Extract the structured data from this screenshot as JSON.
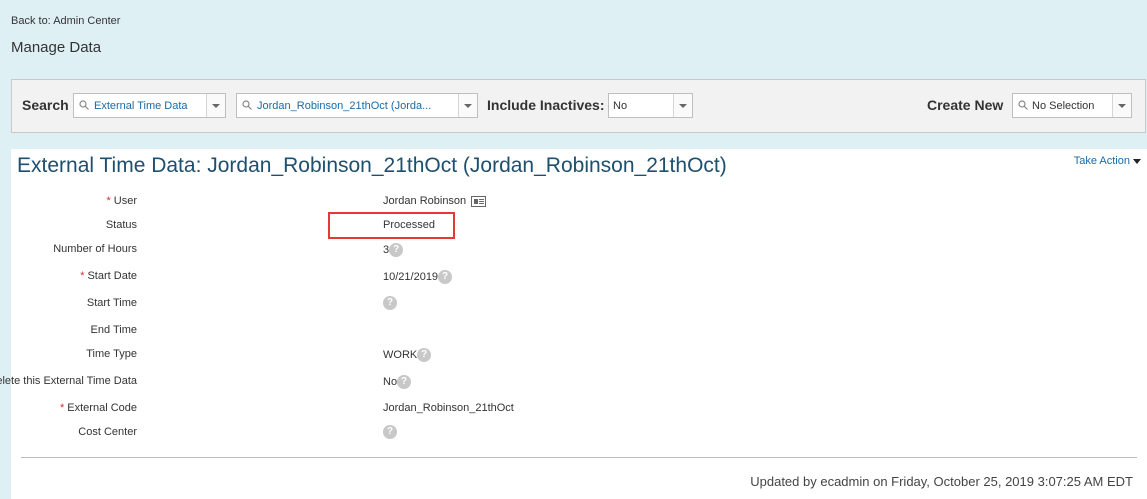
{
  "nav": {
    "back_label": "Back to: Admin Center"
  },
  "page": {
    "title": "Manage Data"
  },
  "search_bar": {
    "search_label": "Search",
    "object_type": "External Time Data",
    "record": "Jordan_Robinson_21thOct (Jorda...",
    "include_inactives_label": "Include Inactives:",
    "include_inactives_value": "No",
    "create_new_label": "Create New",
    "create_new_value": "No Selection"
  },
  "record": {
    "title": "External Time Data: Jordan_Robinson_21thOct (Jordan_Robinson_21thOct)",
    "take_action": "Take Action",
    "fields": {
      "user": {
        "label": "User",
        "value": "Jordan Robinson",
        "required": true
      },
      "status": {
        "label": "Status",
        "value": "Processed"
      },
      "hours": {
        "label": "Number of Hours",
        "value": "3"
      },
      "start_date": {
        "label": "Start Date",
        "value": "10/21/2019",
        "required": true
      },
      "start_time": {
        "label": "Start Time",
        "value": ""
      },
      "end_time": {
        "label": "End Time",
        "value": ""
      },
      "time_type": {
        "label": "Time Type",
        "value": "WORK"
      },
      "delete": {
        "label": "Delete this External Time Data",
        "value": "No"
      },
      "external_code": {
        "label": "External Code",
        "value": "Jordan_Robinson_21thOct",
        "required": true
      },
      "cost_center": {
        "label": "Cost Center",
        "value": ""
      }
    },
    "required_marker": "*",
    "help_glyph": "?",
    "updated": "Updated by ecadmin on Friday, October 25, 2019 3:07:25 AM EDT"
  },
  "colors": {
    "accent_link": "#1a6aa5",
    "title": "#1d4f6e",
    "highlight": "#e53935",
    "required": "#d32f2f"
  }
}
